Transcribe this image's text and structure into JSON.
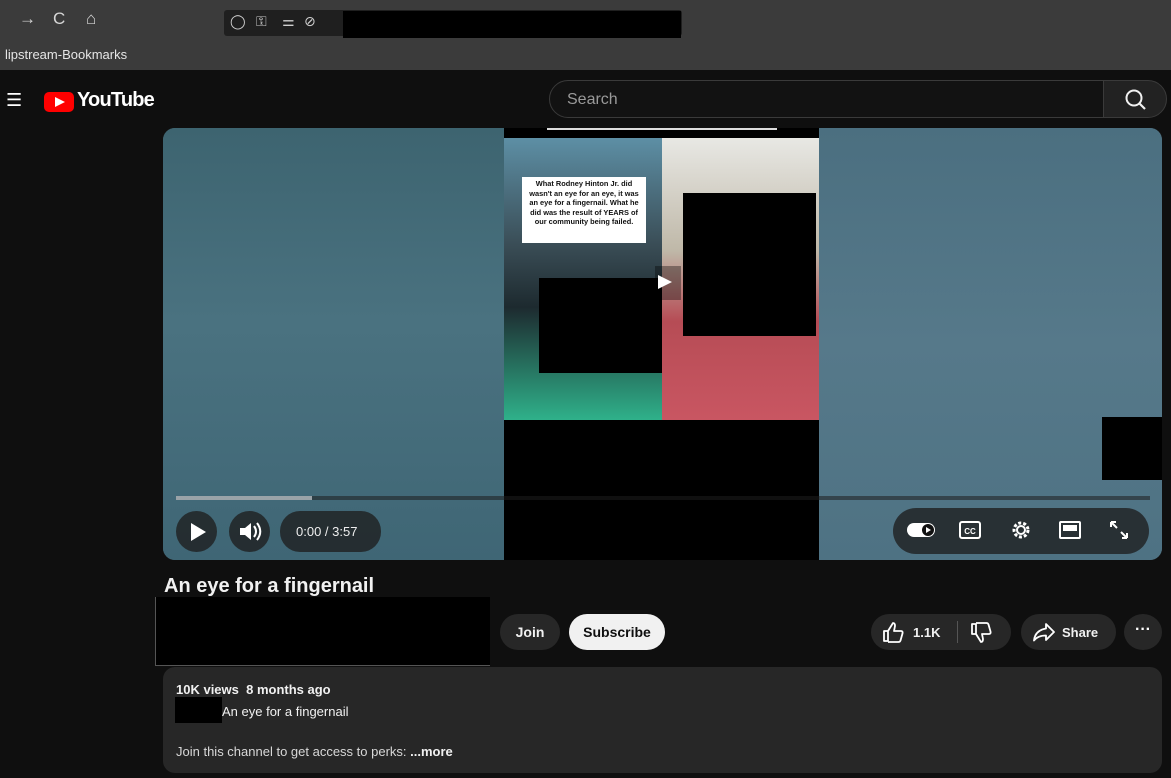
{
  "browser": {
    "bookmark_label": "lipstream-Bookmarks",
    "url": ""
  },
  "masthead": {
    "logo_text": "YouTube",
    "search_placeholder": "Search"
  },
  "player": {
    "caption_text": "What Rodney Hinton Jr. did wasn't an eye for an eye, it was an eye for a fingernail. What he did was the result of YEARS of our community being failed.",
    "time_display": "0:00 / 3:57",
    "progress_fraction": 0.14
  },
  "video": {
    "title": "An eye for a fingernail",
    "join_label": "Join",
    "subscribe_label": "Subscribe",
    "like_count": "1.1K",
    "share_label": "Share"
  },
  "description": {
    "stats": "10K views  8 months ago",
    "title_line": "An eye for a fingernail",
    "join_text": "Join this channel to get access to perks: ",
    "more_label": "...more"
  },
  "colors": {
    "brand_red": "#ff0000",
    "background": "#0f0f0f",
    "surface": "#272727"
  }
}
